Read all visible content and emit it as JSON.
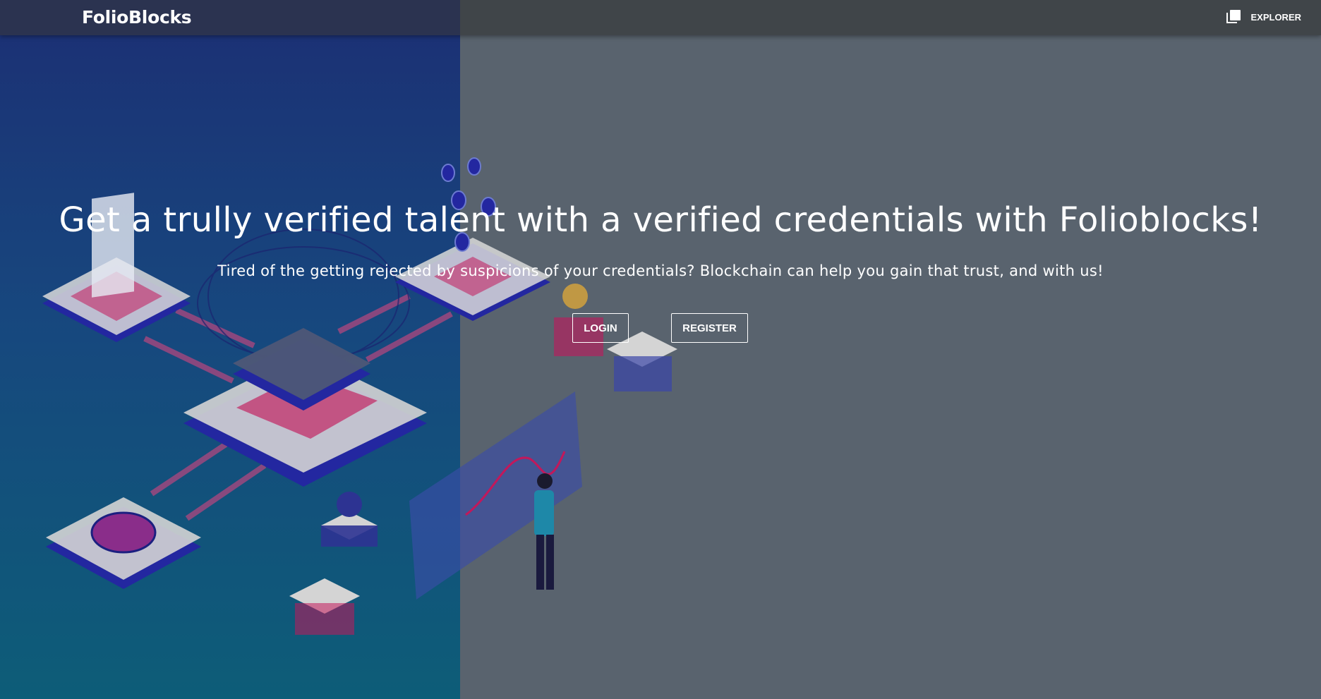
{
  "navbar": {
    "brand": "FolioBlocks",
    "explorer_label": "EXPLORER",
    "explorer_icon": "library-books-icon"
  },
  "hero": {
    "title": "Get a trully verified talent with a verified credentials with Folioblocks!",
    "subtitle": "Tired of the getting rejected by suspicions of your credentials? Blockchain can help you gain that trust, and with us!",
    "login_label": "LOGIN",
    "register_label": "REGISTER"
  },
  "colors": {
    "left_panel_top": "#1c2f74",
    "left_panel_bottom": "#0d5d78",
    "right_panel": "#59636e",
    "nav_left": "#2b3350",
    "nav_right": "#404549",
    "text": "#ffffff"
  }
}
